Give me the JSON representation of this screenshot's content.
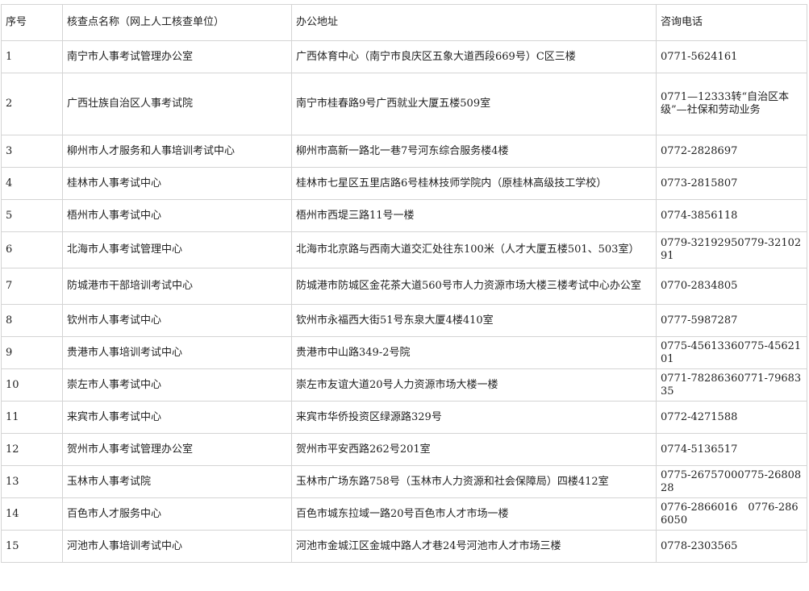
{
  "table": {
    "headers": [
      "序号",
      "核查点名称（网上人工核查单位）",
      "办公地址",
      "咨询电话"
    ],
    "rows": [
      {
        "no": "1",
        "name": "南宁市人事考试管理办公室",
        "address": "广西体育中心（南宁市良庆区五象大道西段669号）C区三楼",
        "phone": "0771-5624161"
      },
      {
        "no": "2",
        "name": "广西壮族自治区人事考试院",
        "address": "南宁市桂春路9号广西就业大厦五楼509室",
        "phone": "0771—12333转“自治区本级”—社保和劳动业务"
      },
      {
        "no": "3",
        "name": "柳州市人才服务和人事培训考试中心",
        "address": "柳州市高新一路北一巷7号河东综合服务楼4楼",
        "phone": "0772-2828697"
      },
      {
        "no": "4",
        "name": "桂林市人事考试中心",
        "address": "桂林市七星区五里店路6号桂林技师学院内（原桂林高级技工学校）",
        "phone": "0773-2815807"
      },
      {
        "no": "5",
        "name": "梧州市人事考试中心",
        "address": "梧州市西堤三路11号一楼",
        "phone": "0774-3856118"
      },
      {
        "no": "6",
        "name": "北海市人事考试管理中心",
        "address": "北海市北京路与西南大道交汇处往东100米（人才大厦五楼501、503室）",
        "phone": "0779-32192950779-3210291"
      },
      {
        "no": "7",
        "name": "防城港市干部培训考试中心",
        "address": "防城港市防城区金花茶大道560号市人力资源市场大楼三楼考试中心办公室",
        "phone": "0770-2834805"
      },
      {
        "no": "8",
        "name": "钦州市人事考试中心",
        "address": "钦州市永福西大街51号东泉大厦4楼410室",
        "phone": "0777-5987287"
      },
      {
        "no": "9",
        "name": "贵港市人事培训考试中心",
        "address": "贵港市中山路349-2号院",
        "phone": "0775-45613360775-4562101"
      },
      {
        "no": "10",
        "name": "崇左市人事考试中心",
        "address": "崇左市友谊大道20号人力资源市场大楼一楼",
        "phone": "0771-78286360771-7968335"
      },
      {
        "no": "11",
        "name": "来宾市人事考试中心",
        "address": "来宾市华侨投资区绿源路329号",
        "phone": "0772-4271588"
      },
      {
        "no": "12",
        "name": "贺州市人事考试管理办公室",
        "address": "贺州市平安西路262号201室",
        "phone": "0774-5136517"
      },
      {
        "no": "13",
        "name": "玉林市人事考试院",
        "address": "玉林市广场东路758号（玉林市人力资源和社会保障局）四楼412室",
        "phone": "0775-26757000775-2680828"
      },
      {
        "no": "14",
        "name": "百色市人才服务中心",
        "address": "百色市城东拉域一路20号百色市人才市场一楼",
        "phone": "0776-2866016　0776-2866050"
      },
      {
        "no": "15",
        "name": "河池市人事培训考试中心",
        "address": "河池市金城江区金城中路人才巷24号河池市人才市场三楼",
        "phone": "0778-2303565"
      }
    ]
  }
}
